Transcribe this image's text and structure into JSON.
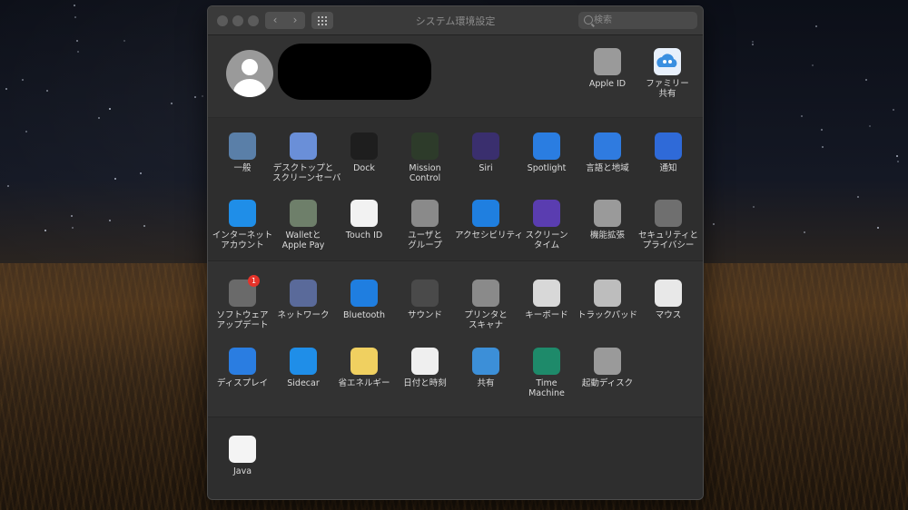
{
  "window": {
    "title": "システム環境設定",
    "search_placeholder": "検索",
    "back_glyph": "‹",
    "forward_glyph": "›"
  },
  "account": {
    "apple_id": "Apple ID",
    "family_sharing": [
      "ファミリー",
      "共有"
    ]
  },
  "row1": [
    {
      "id": "general",
      "lines": [
        "一般"
      ],
      "icon": "general-icon",
      "color": "#5a7fa8"
    },
    {
      "id": "desktop",
      "lines": [
        "デスクトップと",
        "スクリーンセーバ"
      ],
      "icon": "desktop-icon",
      "color": "#6a8fd8"
    },
    {
      "id": "dock",
      "lines": [
        "Dock"
      ],
      "icon": "dock-icon",
      "color": "#1e1e1e"
    },
    {
      "id": "mission",
      "lines": [
        "Mission",
        "Control"
      ],
      "icon": "mission-control-icon",
      "color": "#2d3b2a"
    },
    {
      "id": "siri",
      "lines": [
        "Siri"
      ],
      "icon": "siri-icon",
      "color": "#3a2f6e"
    },
    {
      "id": "spotlight",
      "lines": [
        "Spotlight"
      ],
      "icon": "spotlight-icon",
      "color": "#2a7de1"
    },
    {
      "id": "language",
      "lines": [
        "言語と地域"
      ],
      "icon": "language-icon",
      "color": "#2f7be0"
    },
    {
      "id": "notifications",
      "lines": [
        "通知"
      ],
      "icon": "notifications-icon",
      "color": "#2f6ad8"
    }
  ],
  "row2": [
    {
      "id": "internet",
      "lines": [
        "インターネット",
        "アカウント"
      ],
      "icon": "internet-accounts-icon",
      "color": "#1f8ee8"
    },
    {
      "id": "wallet",
      "lines": [
        "Walletと",
        "Apple Pay"
      ],
      "icon": "wallet-icon",
      "color": "#6e7f6a"
    },
    {
      "id": "touchid",
      "lines": [
        "Touch ID"
      ],
      "icon": "touch-id-icon",
      "color": "#f2f2f2"
    },
    {
      "id": "users",
      "lines": [
        "ユーザと",
        "グループ"
      ],
      "icon": "users-groups-icon",
      "color": "#8a8a8a"
    },
    {
      "id": "accessibility",
      "lines": [
        "アクセシビリティ"
      ],
      "icon": "accessibility-icon",
      "color": "#1f7fe0"
    },
    {
      "id": "screentime",
      "lines": [
        "スクリーン",
        "タイム"
      ],
      "icon": "screen-time-icon",
      "color": "#5a3db0"
    },
    {
      "id": "extensions",
      "lines": [
        "機能拡張"
      ],
      "icon": "extensions-icon",
      "color": "#9a9a9a"
    },
    {
      "id": "security",
      "lines": [
        "セキュリティと",
        "プライバシー"
      ],
      "icon": "security-privacy-icon",
      "color": "#6f6f6f"
    }
  ],
  "row3": [
    {
      "id": "update",
      "lines": [
        "ソフトウェア",
        "アップデート"
      ],
      "icon": "software-update-icon",
      "color": "#6a6a6a",
      "badge": "1"
    },
    {
      "id": "network",
      "lines": [
        "ネットワーク"
      ],
      "icon": "network-icon",
      "color": "#5a6a9a"
    },
    {
      "id": "bluetooth",
      "lines": [
        "Bluetooth"
      ],
      "icon": "bluetooth-icon",
      "color": "#1f7ee0"
    },
    {
      "id": "sound",
      "lines": [
        "サウンド"
      ],
      "icon": "sound-icon",
      "color": "#4a4a4a"
    },
    {
      "id": "printers",
      "lines": [
        "プリンタと",
        "スキャナ"
      ],
      "icon": "printers-icon",
      "color": "#8a8a8a"
    },
    {
      "id": "keyboard",
      "lines": [
        "キーボード"
      ],
      "icon": "keyboard-icon",
      "color": "#d8d8d8"
    },
    {
      "id": "trackpad",
      "lines": [
        "トラックパッド"
      ],
      "icon": "trackpad-icon",
      "color": "#bdbdbd"
    },
    {
      "id": "mouse",
      "lines": [
        "マウス"
      ],
      "icon": "mouse-icon",
      "color": "#e8e8e8"
    }
  ],
  "row4": [
    {
      "id": "displays",
      "lines": [
        "ディスプレイ"
      ],
      "icon": "displays-icon",
      "color": "#2a7de1"
    },
    {
      "id": "sidecar",
      "lines": [
        "Sidecar"
      ],
      "icon": "sidecar-icon",
      "color": "#1f8ee8"
    },
    {
      "id": "energy",
      "lines": [
        "省エネルギー"
      ],
      "icon": "energy-saver-icon",
      "color": "#f0d060"
    },
    {
      "id": "datetime",
      "lines": [
        "日付と時刻"
      ],
      "icon": "date-time-icon",
      "color": "#efefef"
    },
    {
      "id": "sharing",
      "lines": [
        "共有"
      ],
      "icon": "sharing-icon",
      "color": "#3c8fd8"
    },
    {
      "id": "timemachine",
      "lines": [
        "Time",
        "Machine"
      ],
      "icon": "time-machine-icon",
      "color": "#1e8a6a"
    },
    {
      "id": "startup",
      "lines": [
        "起動ディスク"
      ],
      "icon": "startup-disk-icon",
      "color": "#9a9a9a"
    }
  ],
  "other": [
    {
      "id": "java",
      "lines": [
        "Java"
      ],
      "icon": "java-icon",
      "color": "#f4f4f4"
    }
  ]
}
